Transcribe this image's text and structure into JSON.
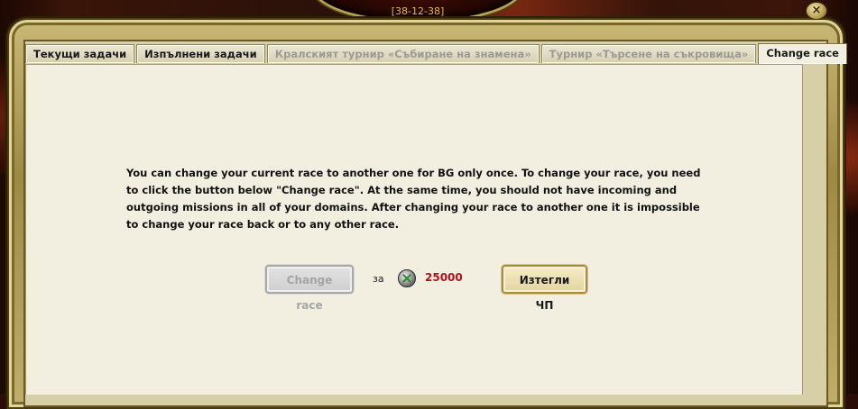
{
  "header": {
    "coords": "[38-12-38]"
  },
  "window": {
    "close_label": "×"
  },
  "tabs": [
    {
      "label": "Текущи задачи",
      "state": "normal"
    },
    {
      "label": "Изпълнени задачи",
      "state": "normal"
    },
    {
      "label": "Кралският турнир «Събиране на знамена»",
      "state": "disabled"
    },
    {
      "label": "Турнир «Търсене на съкровища»",
      "state": "disabled"
    },
    {
      "label": "Change race",
      "state": "active"
    }
  ],
  "content": {
    "description": "You can change your current race to another one for BG only once. To change your race, you need to click the button below \"Change race\". At the same time, you should not have incoming and outgoing missions in all of your domains. After changing your race to another one it is impossible to change your race back or to any other race.",
    "change_race_button": "Change race",
    "for_label": "за",
    "currency_icon": "crossed-swords-coin-icon",
    "price": "25000",
    "price_color": "#b0121a",
    "buy_button": "Изтегли ЧП"
  }
}
